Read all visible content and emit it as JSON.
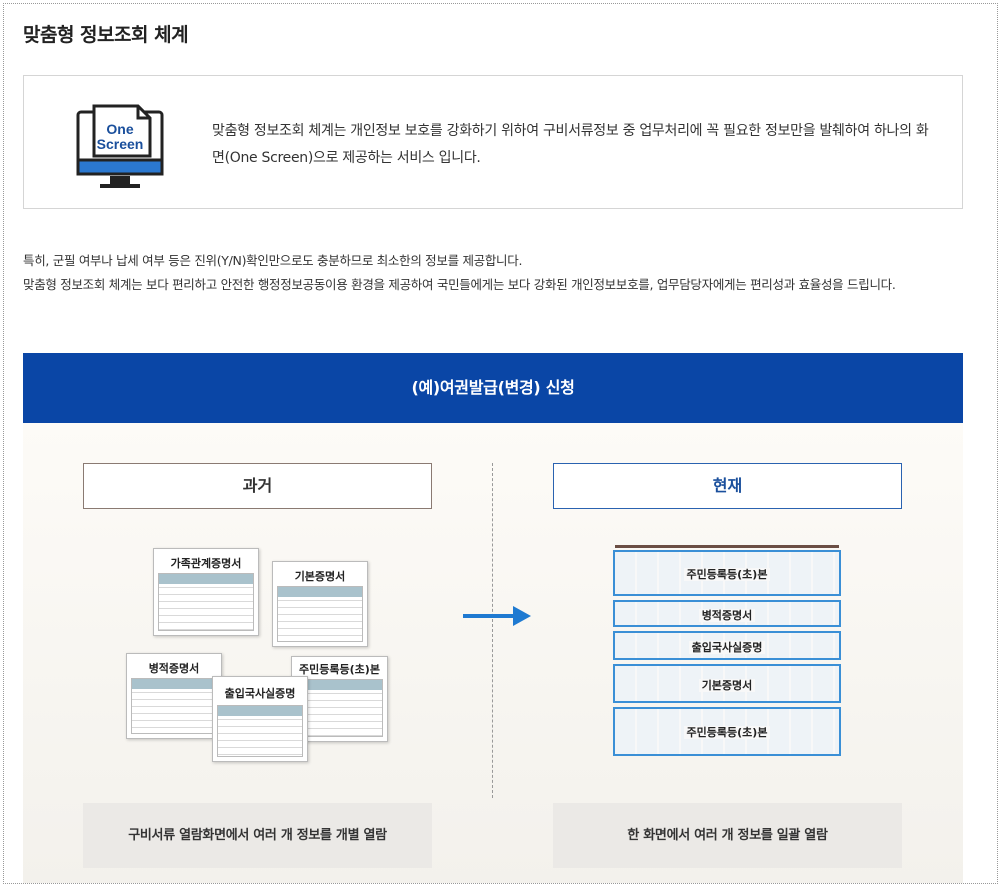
{
  "page": {
    "title": "맞춤형 정보조회 체계"
  },
  "intro": {
    "icon_line1": "One",
    "icon_line2": "Screen",
    "text": "맞춤형 정보조회 체계는 개인정보 보호를 강화하기 위하여 구비서류정보 중 업무처리에 꼭 필요한 정보만을 발췌하여 하나의 화면(One Screen)으로 제공하는 서비스 입니다."
  },
  "description": {
    "line1": "특히, 군필 여부나 납세 여부 등은 진위(Y/N)확인만으로도 충분하므로 최소한의 정보를 제공합니다.",
    "line2": "맞춤형 정보조회 체계는 보다 편리하고 안전한 행정정보공동이용 환경을 제공하여 국민들에게는 보다 강화된 개인정보보호를, 업무담당자에게는 편리성과 효율성을 드립니다."
  },
  "banner": {
    "title": "(예)여권발급(변경) 신청"
  },
  "past": {
    "header": "과거",
    "caption": "구비서류 열람화면에서 여러 개 정보를 개별 열람",
    "docs": [
      "가족관계증명서",
      "기본증명서",
      "병적증명서",
      "주민등록등(초)본",
      "출입국사실증명"
    ]
  },
  "present": {
    "header": "현재",
    "caption": "한 화면에서 여러 개 정보를 일괄 열람",
    "docs": [
      "주민등록등(초)본",
      "병적증명서",
      "출입국사실증명",
      "기본증명서",
      "주민등록등(초)본"
    ]
  },
  "colors": {
    "banner": "#0a46a6",
    "present_accent": "#2a62b0",
    "arrow": "#1f7ad1"
  }
}
